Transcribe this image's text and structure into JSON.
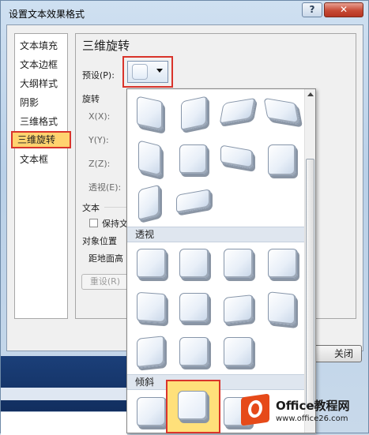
{
  "dialog": {
    "title": "设置文本效果格式",
    "help_label": "?",
    "close_label": "✕"
  },
  "nav": {
    "items": [
      {
        "label": "文本填充"
      },
      {
        "label": "文本边框"
      },
      {
        "label": "大纲样式"
      },
      {
        "label": "阴影"
      },
      {
        "label": "三维格式"
      },
      {
        "label": "三维旋转",
        "selected": true
      },
      {
        "label": "文本框"
      }
    ]
  },
  "panel": {
    "heading": "三维旋转",
    "preset_label": "预设(P):",
    "rotation_label": "旋转",
    "x_label": "X(X):",
    "y_label": "Y(Y):",
    "z_label": "Z(Z):",
    "perspective_label": "透视(E):",
    "text_section_label": "文本",
    "keep_text_label": "保持文",
    "object_position_label": "对象位置",
    "distance_label": "距地面高",
    "reset_label": "重设(R)",
    "close_button_label": "关闭"
  },
  "dropdown": {
    "section_perspective": "透视",
    "section_oblique": "倾斜"
  },
  "watermark": {
    "name": "Office教程网",
    "url": "www.office26.com"
  },
  "colors": {
    "highlight_border": "#d9342b",
    "selected_fill": "#ffd36f",
    "header_fill": "#dfe6ef"
  }
}
